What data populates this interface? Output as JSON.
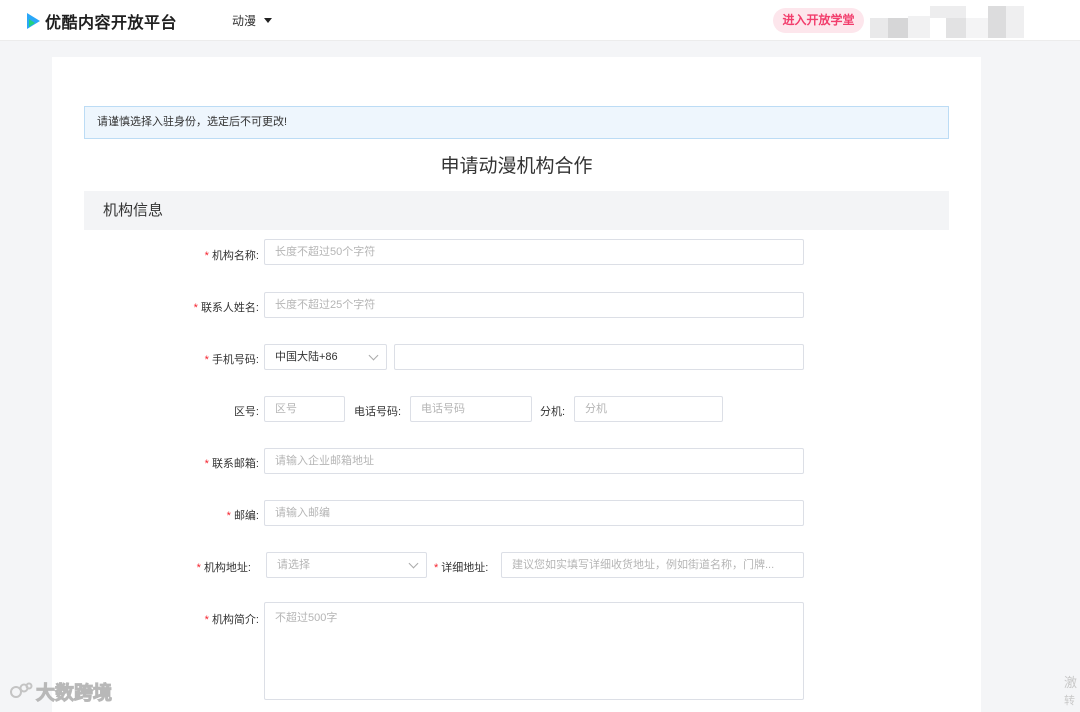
{
  "header": {
    "logo_text": "优酷内容开放平台",
    "category": "动漫",
    "academy_button": "进入开放学堂"
  },
  "notice": "请谨慎选择入驻身份，选定后不可更改!",
  "page_title": "申请动漫机构合作",
  "section_title": "机构信息",
  "form": {
    "org_name": {
      "label": "机构名称:",
      "placeholder": "长度不超过50个字符"
    },
    "contact_name": {
      "label": "联系人姓名:",
      "placeholder": "长度不超过25个字符"
    },
    "mobile": {
      "label": "手机号码:",
      "region": "中国大陆+86",
      "value": ""
    },
    "area_code": {
      "label": "区号:",
      "placeholder": "区号"
    },
    "phone": {
      "label": "电话号码:",
      "placeholder": "电话号码"
    },
    "extension": {
      "label": "分机:",
      "placeholder": "分机"
    },
    "email": {
      "label": "联系邮箱:",
      "placeholder": "请输入企业邮箱地址"
    },
    "postcode": {
      "label": "邮编:",
      "placeholder": "请输入邮编"
    },
    "address": {
      "label": "机构地址:",
      "placeholder": "请选择"
    },
    "detail_address": {
      "label": "详细地址:",
      "placeholder": "建议您如实填写详细收货地址，例如街道名称，门牌..."
    },
    "intro": {
      "label": "机构简介:",
      "placeholder": "不超过500字"
    }
  },
  "watermark": "大数跨境",
  "side_text": {
    "line1": "激",
    "line2": "转"
  },
  "colors": {
    "accent": "#2aa7f8",
    "required": "#f5222d",
    "academy": "#f23d6c"
  }
}
